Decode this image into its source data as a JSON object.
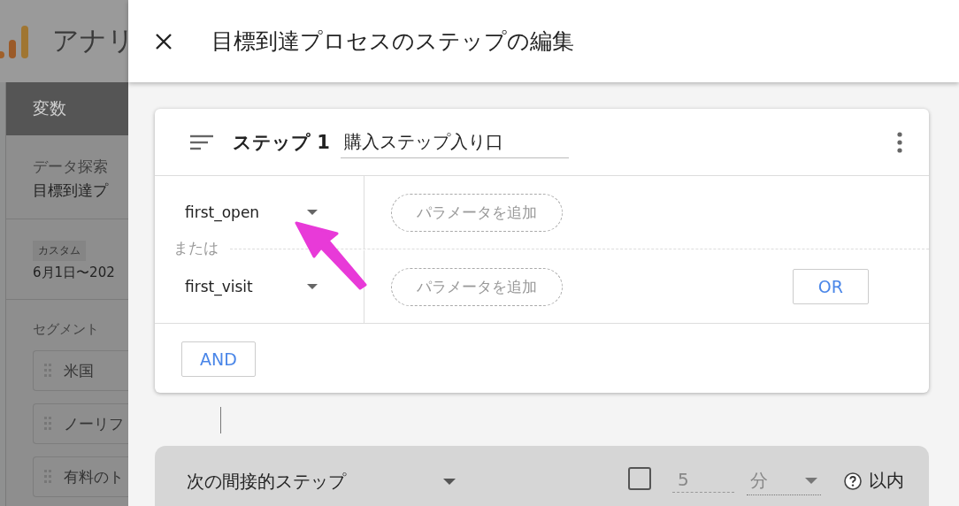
{
  "background": {
    "app_title": "アナリ",
    "sidebar": {
      "header": "変数",
      "exploration_label": "データ探索",
      "exploration_name": "目標到達プ",
      "date_chip": "カスタム",
      "date_range": "6月1日〜202",
      "segments_label": "セグメント",
      "segments": [
        "米国",
        "ノーリフ",
        "有料のト"
      ]
    }
  },
  "dialog": {
    "title": "目標到達プロセスのステップの編集",
    "step": {
      "label": "ステップ 1",
      "name": "購入ステップ入り口",
      "conditions": [
        {
          "event": "first_open",
          "parameter_placeholder": "パラメータを追加"
        },
        {
          "event": "first_visit",
          "parameter_placeholder": "パラメータを追加"
        }
      ],
      "or_separator": "または",
      "or_button": "OR",
      "and_button": "AND"
    },
    "next": {
      "mode": "次の間接的ステップ",
      "time_limit": {
        "checked": false,
        "value": "5",
        "unit": "分",
        "suffix": "以内"
      }
    }
  }
}
